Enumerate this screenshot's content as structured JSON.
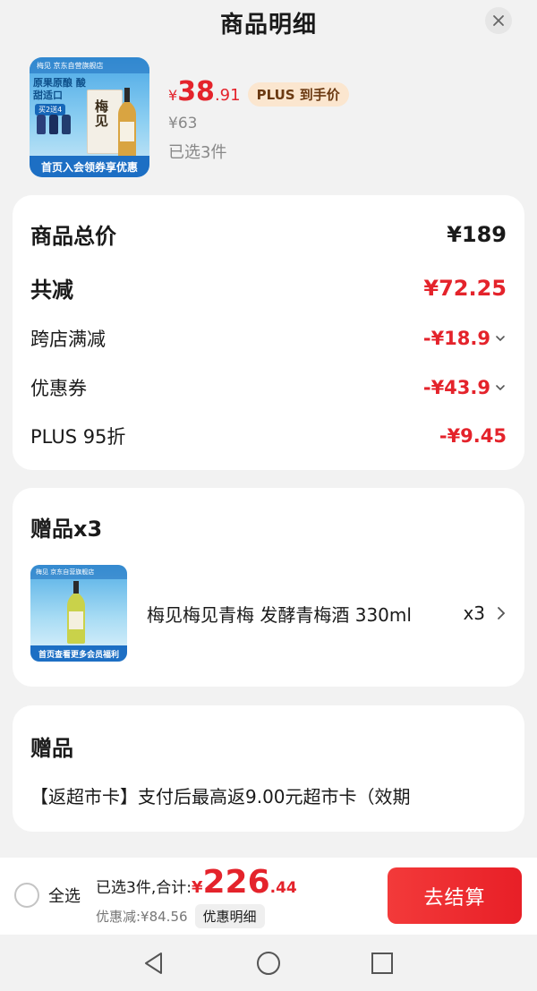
{
  "header": {
    "title": "商品明细"
  },
  "product": {
    "brand_strip": "梅见  京东自营旗舰店",
    "thumb_tag1": "原果原酿 酸甜适口",
    "thumb_tag2": "买2送4",
    "thumb_box_char": "梅见",
    "thumb_banner": "首页入会领券享优惠",
    "price_yen": "¥",
    "price_int": "38",
    "price_dec": ".91",
    "plus_badge": "PLUS 到手价",
    "original_price": "¥63",
    "selected": "已选3件"
  },
  "price_breakdown": {
    "total_label": "商品总价",
    "total_value": "¥189",
    "reduce_label": "共减",
    "reduce_value": "¥72.25",
    "items": [
      {
        "label": "跨店满减",
        "value": "-¥18.9"
      },
      {
        "label": "优惠券",
        "value": "-¥43.9"
      },
      {
        "label": "PLUS 95折",
        "value": "-¥9.45"
      }
    ]
  },
  "gifts": {
    "title": "赠品x3",
    "item": {
      "thumb_brand": "梅见  京东自营旗舰店",
      "thumb_banner": "首页查看更多会员福利",
      "name": "梅见梅见青梅 发酵青梅酒 330ml",
      "qty": "x3"
    }
  },
  "gifts2": {
    "title": "赠品",
    "desc": "【返超市卡】支付后最高返9.00元超市卡（效期"
  },
  "bottom_bar": {
    "select_all": "全选",
    "total_prefix": "已选3件,合计:",
    "total_yen": "¥",
    "total_int": "226",
    "total_dec": ".44",
    "discount": "优惠减:¥84.56",
    "detail_btn": "优惠明细",
    "checkout": "去结算"
  },
  "colors": {
    "accent_red": "#e4232b",
    "plus_gold": "#fbe6cf",
    "banner_blue": "#1d6fc4"
  },
  "icons": [
    "close-icon",
    "chevron-down-icon",
    "chevron-right-icon",
    "nav-back-icon",
    "nav-home-icon",
    "nav-recents-icon"
  ]
}
